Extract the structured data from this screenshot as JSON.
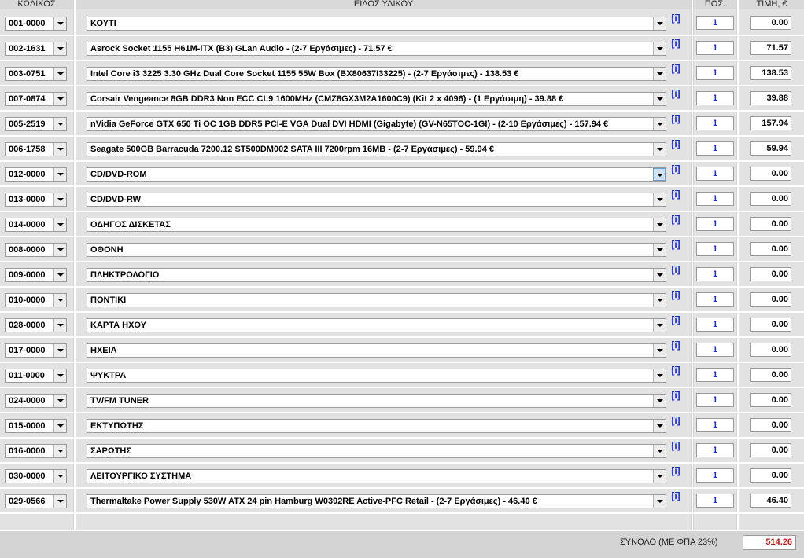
{
  "headers": {
    "code": "ΚΩΔΙΚΟΣ",
    "item": "ΕΙΔΟΣ ΥΛΙΚΟΥ",
    "qty": "ΠΟΣ.",
    "price": "ΤΙΜΗ, €"
  },
  "info_label": "[i]",
  "rows": [
    {
      "code": "001-0000",
      "item": "ΚΟΥΤΙ",
      "qty": "1",
      "price": "0.00"
    },
    {
      "code": "002-1631",
      "item": "Asrock Socket 1155 H61M-ITX (B3) GLan Audio - (2-7 Εργάσιμες) - 71.57 €",
      "qty": "1",
      "price": "71.57"
    },
    {
      "code": "003-0751",
      "item": "Intel Core i3 3225 3.30 GHz Dual Core Socket 1155 55W Box (BX80637I33225) - (2-7 Εργάσιμες) - 138.53 €",
      "qty": "1",
      "price": "138.53"
    },
    {
      "code": "007-0874",
      "item": "Corsair Vengeance 8GB DDR3 Non ECC CL9 1600MHz (CMZ8GX3M2A1600C9) (Kit 2 x 4096) - (1 Εργάσιμη) - 39.88 €",
      "qty": "1",
      "price": "39.88"
    },
    {
      "code": "005-2519",
      "item": "nVidia GeForce GTX 650 Ti OC 1GB DDR5 PCI-E VGA Dual DVI HDMI (Gigabyte) (GV-N65TOC-1GI) - (2-10 Εργάσιμες) - 157.94 €",
      "qty": "1",
      "price": "157.94"
    },
    {
      "code": "006-1758",
      "item": "Seagate 500GB Barracuda 7200.12 ST500DM002 SATA III 7200rpm 16MB - (2-7 Εργάσιμες) - 59.94 €",
      "qty": "1",
      "price": "59.94"
    },
    {
      "code": "012-0000",
      "item": "CD/DVD-ROM",
      "qty": "1",
      "price": "0.00"
    },
    {
      "code": "013-0000",
      "item": "CD/DVD-RW",
      "qty": "1",
      "price": "0.00"
    },
    {
      "code": "014-0000",
      "item": "ΟΔΗΓΟΣ ΔΙΣΚΕΤΑΣ",
      "qty": "1",
      "price": "0.00"
    },
    {
      "code": "008-0000",
      "item": "ΟΘΟΝΗ",
      "qty": "1",
      "price": "0.00"
    },
    {
      "code": "009-0000",
      "item": "ΠΛΗΚΤΡΟΛΟΓΙΟ",
      "qty": "1",
      "price": "0.00"
    },
    {
      "code": "010-0000",
      "item": "ΠΟΝΤΙΚΙ",
      "qty": "1",
      "price": "0.00"
    },
    {
      "code": "028-0000",
      "item": "ΚΑΡΤΑ ΗΧΟΥ",
      "qty": "1",
      "price": "0.00"
    },
    {
      "code": "017-0000",
      "item": "ΗΧΕΙΑ",
      "qty": "1",
      "price": "0.00"
    },
    {
      "code": "011-0000",
      "item": "ΨΥΚΤΡΑ",
      "qty": "1",
      "price": "0.00"
    },
    {
      "code": "024-0000",
      "item": "TV/FM TUNER",
      "qty": "1",
      "price": "0.00"
    },
    {
      "code": "015-0000",
      "item": "ΕΚΤΥΠΩΤΗΣ",
      "qty": "1",
      "price": "0.00"
    },
    {
      "code": "016-0000",
      "item": "ΣΑΡΩΤΗΣ",
      "qty": "1",
      "price": "0.00"
    },
    {
      "code": "030-0000",
      "item": "ΛΕΙΤΟΥΡΓΙΚΟ ΣΥΣΤΗΜΑ",
      "qty": "1",
      "price": "0.00"
    },
    {
      "code": "029-0566",
      "item": "Thermaltake Power Supply 530W ATX 24 pin Hamburg W0392RE Active-PFC Retail - (2-7 Εργάσιμες) - 46.40 €",
      "qty": "1",
      "price": "46.40"
    }
  ],
  "total": {
    "label": "ΣΥΝΟΛΟ (ΜΕ ΦΠΑ 23%)",
    "value": "514.26"
  }
}
